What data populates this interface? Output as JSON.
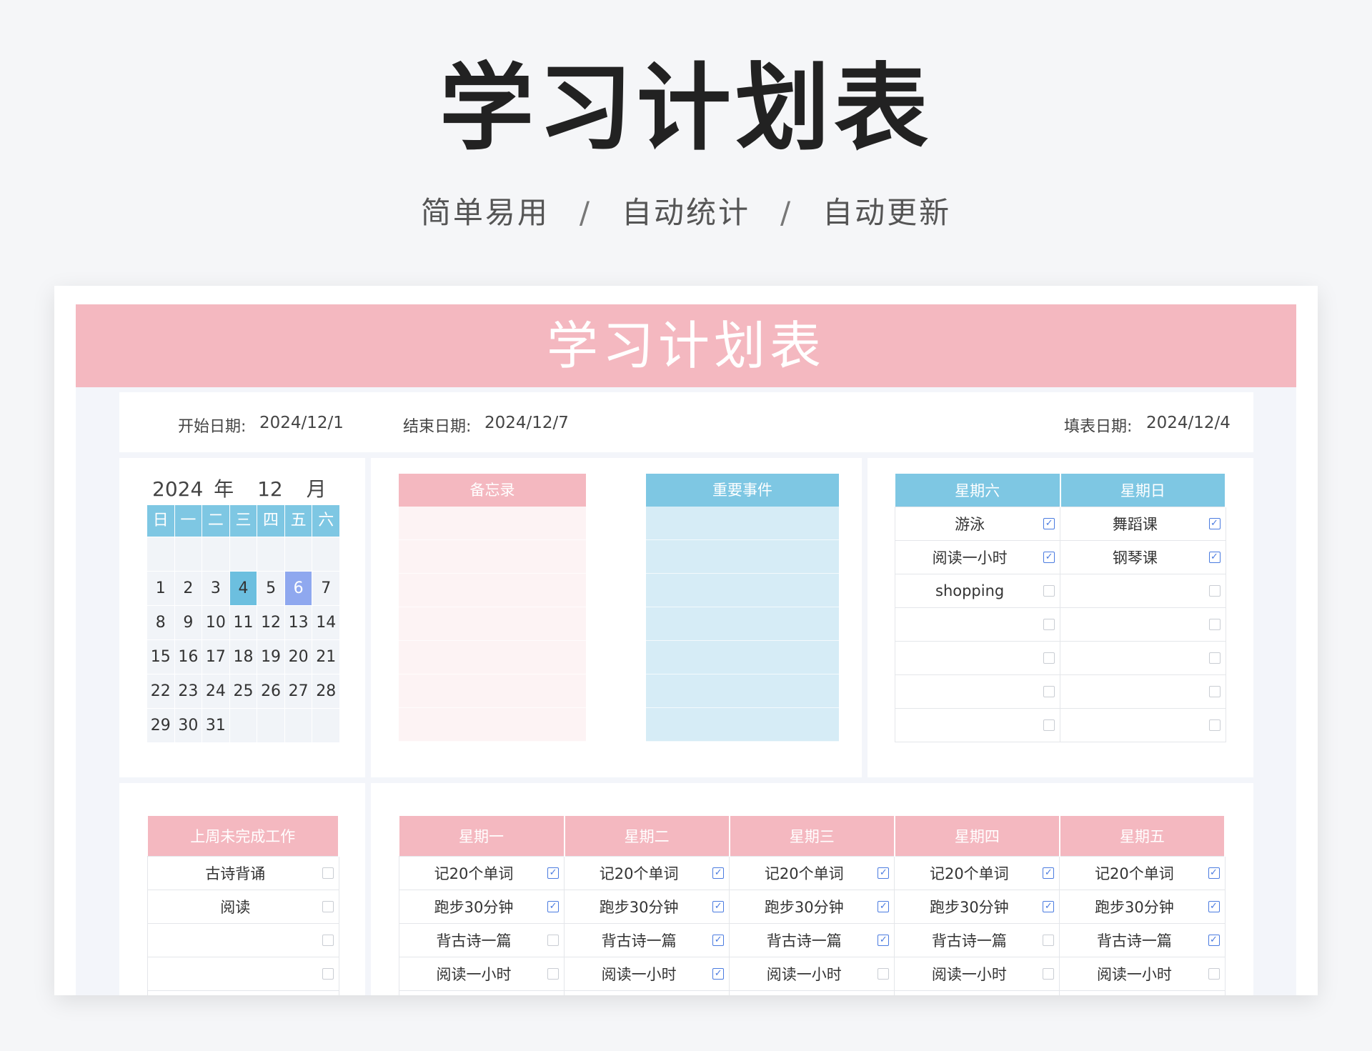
{
  "hero": {
    "title": "学习计划表",
    "subtitle": [
      "简单易用",
      "自动统计",
      "自动更新"
    ],
    "separator": "/"
  },
  "sheet": {
    "banner_title": "学习计划表",
    "dates": {
      "start_label": "开始日期:",
      "start_value": "2024/12/1",
      "end_label": "结束日期:",
      "end_value": "2024/12/7",
      "fill_label": "填表日期:",
      "fill_value": "2024/12/4"
    },
    "calendar": {
      "year": "2024",
      "year_unit": "年",
      "month": "12",
      "month_unit": "月",
      "weekdays": [
        "日",
        "一",
        "二",
        "三",
        "四",
        "五",
        "六"
      ],
      "cells": [
        "",
        "",
        "",
        "",
        "",
        "",
        "",
        "1",
        "2",
        "3",
        "4",
        "5",
        "6",
        "7",
        "8",
        "9",
        "10",
        "11",
        "12",
        "13",
        "14",
        "15",
        "16",
        "17",
        "18",
        "19",
        "20",
        "21",
        "22",
        "23",
        "24",
        "25",
        "26",
        "27",
        "28",
        "29",
        "30",
        "31",
        "",
        "",
        "",
        ""
      ],
      "today": "4",
      "selected": "6"
    },
    "memo": {
      "title": "备忘录",
      "rows": 7,
      "color": "#f4b8c0",
      "fill": "#fdf3f4"
    },
    "important": {
      "title": "重要事件",
      "rows": 7,
      "color": "#7ec7e3",
      "fill": "#d6ecf6"
    },
    "weekend": {
      "headers": [
        "星期六",
        "星期日"
      ],
      "rows": [
        [
          {
            "text": "游泳",
            "done": true
          },
          {
            "text": "舞蹈课",
            "done": true
          }
        ],
        [
          {
            "text": "阅读一小时",
            "done": true
          },
          {
            "text": "钢琴课",
            "done": true
          }
        ],
        [
          {
            "text": "shopping",
            "done": false
          },
          {
            "text": "",
            "done": false
          }
        ],
        [
          {
            "text": "",
            "done": false
          },
          {
            "text": "",
            "done": false
          }
        ],
        [
          {
            "text": "",
            "done": false
          },
          {
            "text": "",
            "done": false
          }
        ],
        [
          {
            "text": "",
            "done": false
          },
          {
            "text": "",
            "done": false
          }
        ],
        [
          {
            "text": "",
            "done": false
          },
          {
            "text": "",
            "done": false
          }
        ]
      ]
    },
    "last_week": {
      "header": "上周未完成工作",
      "rows": [
        {
          "text": "古诗背诵",
          "done": false
        },
        {
          "text": "阅读",
          "done": false
        },
        {
          "text": "",
          "done": false
        },
        {
          "text": "",
          "done": false
        },
        {
          "text": "",
          "done": false
        }
      ]
    },
    "weekdays": {
      "headers": [
        "星期一",
        "星期二",
        "星期三",
        "星期四",
        "星期五"
      ],
      "rows": [
        [
          {
            "text": "记20个单词",
            "done": true
          },
          {
            "text": "记20个单词",
            "done": true
          },
          {
            "text": "记20个单词",
            "done": true
          },
          {
            "text": "记20个单词",
            "done": true
          },
          {
            "text": "记20个单词",
            "done": true
          }
        ],
        [
          {
            "text": "跑步30分钟",
            "done": true
          },
          {
            "text": "跑步30分钟",
            "done": true
          },
          {
            "text": "跑步30分钟",
            "done": true
          },
          {
            "text": "跑步30分钟",
            "done": true
          },
          {
            "text": "跑步30分钟",
            "done": true
          }
        ],
        [
          {
            "text": "背古诗一篇",
            "done": false
          },
          {
            "text": "背古诗一篇",
            "done": true
          },
          {
            "text": "背古诗一篇",
            "done": true
          },
          {
            "text": "背古诗一篇",
            "done": false
          },
          {
            "text": "背古诗一篇",
            "done": true
          }
        ],
        [
          {
            "text": "阅读一小时",
            "done": false
          },
          {
            "text": "阅读一小时",
            "done": true
          },
          {
            "text": "阅读一小时",
            "done": false
          },
          {
            "text": "阅读一小时",
            "done": false
          },
          {
            "text": "阅读一小时",
            "done": false
          }
        ],
        [
          {
            "text": "",
            "done": false
          },
          {
            "text": "",
            "done": false
          },
          {
            "text": "",
            "done": false
          },
          {
            "text": "",
            "done": false
          },
          {
            "text": "",
            "done": false
          }
        ]
      ]
    }
  }
}
